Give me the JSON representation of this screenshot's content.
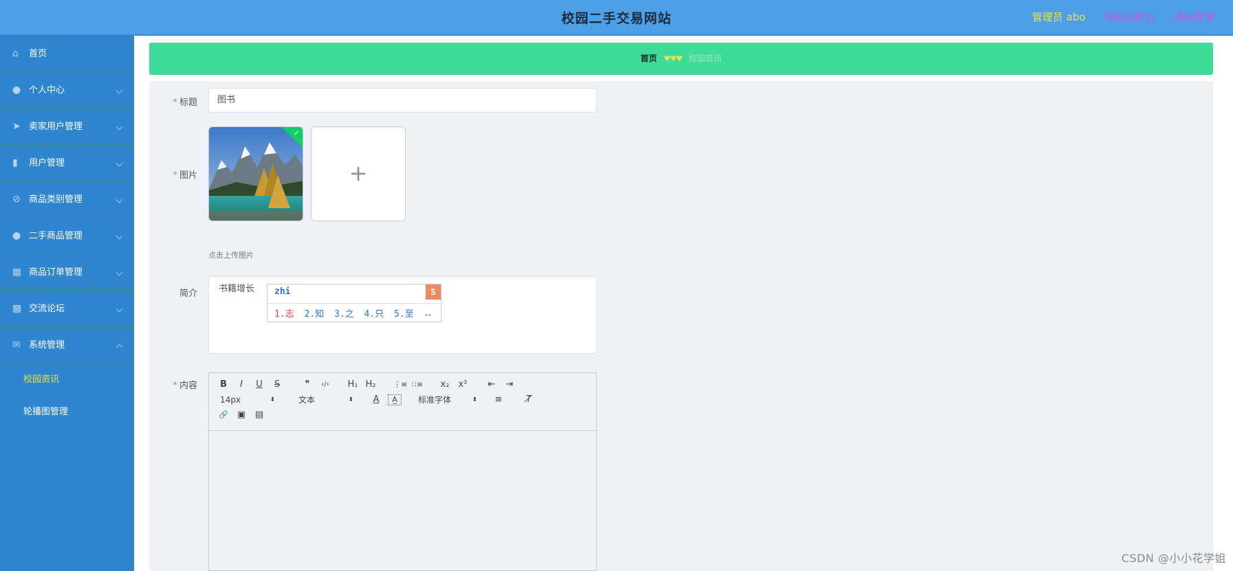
{
  "header": {
    "title": "校园二手交易网站",
    "admin": "管理员 abo",
    "back_front": "退出到前台",
    "logout": "退出登录"
  },
  "sidebar": {
    "items": [
      {
        "label": "首页",
        "icon": "home-icon",
        "glyph": "⌂"
      },
      {
        "label": "个人中心",
        "icon": "user-icon",
        "glyph": "●"
      },
      {
        "label": "卖家用户管理",
        "icon": "paper-plane-icon",
        "glyph": "➤"
      },
      {
        "label": "用户管理",
        "icon": "bar-chart-icon",
        "glyph": "▮"
      },
      {
        "label": "商品类别管理",
        "icon": "tag-icon",
        "glyph": "⊘"
      },
      {
        "label": "二手商品管理",
        "icon": "user-icon",
        "glyph": "●"
      },
      {
        "label": "商品订单管理",
        "icon": "grid-icon",
        "glyph": "▦"
      },
      {
        "label": "交流论坛",
        "icon": "apps-icon",
        "glyph": "▩"
      },
      {
        "label": "系统管理",
        "icon": "mail-icon",
        "glyph": "✉"
      }
    ],
    "sub_items": [
      "校园资讯",
      "轮播图管理"
    ]
  },
  "breadcrumb": {
    "home": "首页",
    "separator": "♥♥♥",
    "current": "校园资讯"
  },
  "form": {
    "title_label": "标题",
    "title_value": "图书",
    "image_label": "图片",
    "upload_plus": "+",
    "upload_tip": "点击上传图片",
    "intro_label": "简介",
    "intro_value": "书籍增长",
    "content_label": "内容"
  },
  "ime": {
    "pinyin": "zhi",
    "logo": "S",
    "candidates": [
      "1.志",
      "2.知",
      "3.之",
      "4.只",
      "5.至"
    ],
    "arrows": "◂▸"
  },
  "editor": {
    "font_size": "14px",
    "block_format": "文本",
    "font_family": "标准字体",
    "select_arrow": "⬍",
    "buttons": {
      "bold": "B",
      "italic": "I",
      "underline": "U",
      "strike": "S",
      "quote": "❞",
      "code": "‹/›",
      "h1": "H₁",
      "h2": "H₂",
      "ordered_list": "⋮≡",
      "bullet_list": "∷≡",
      "subscript": "x₂",
      "superscript": "x²",
      "outdent": "⇤",
      "indent": "⇥",
      "font_color": "A",
      "background": "A̲",
      "align": "≡",
      "clean": "T̸",
      "link": "🔗",
      "image": "▣",
      "video": "▤"
    }
  },
  "watermark": "CSDN @小小花学姐"
}
